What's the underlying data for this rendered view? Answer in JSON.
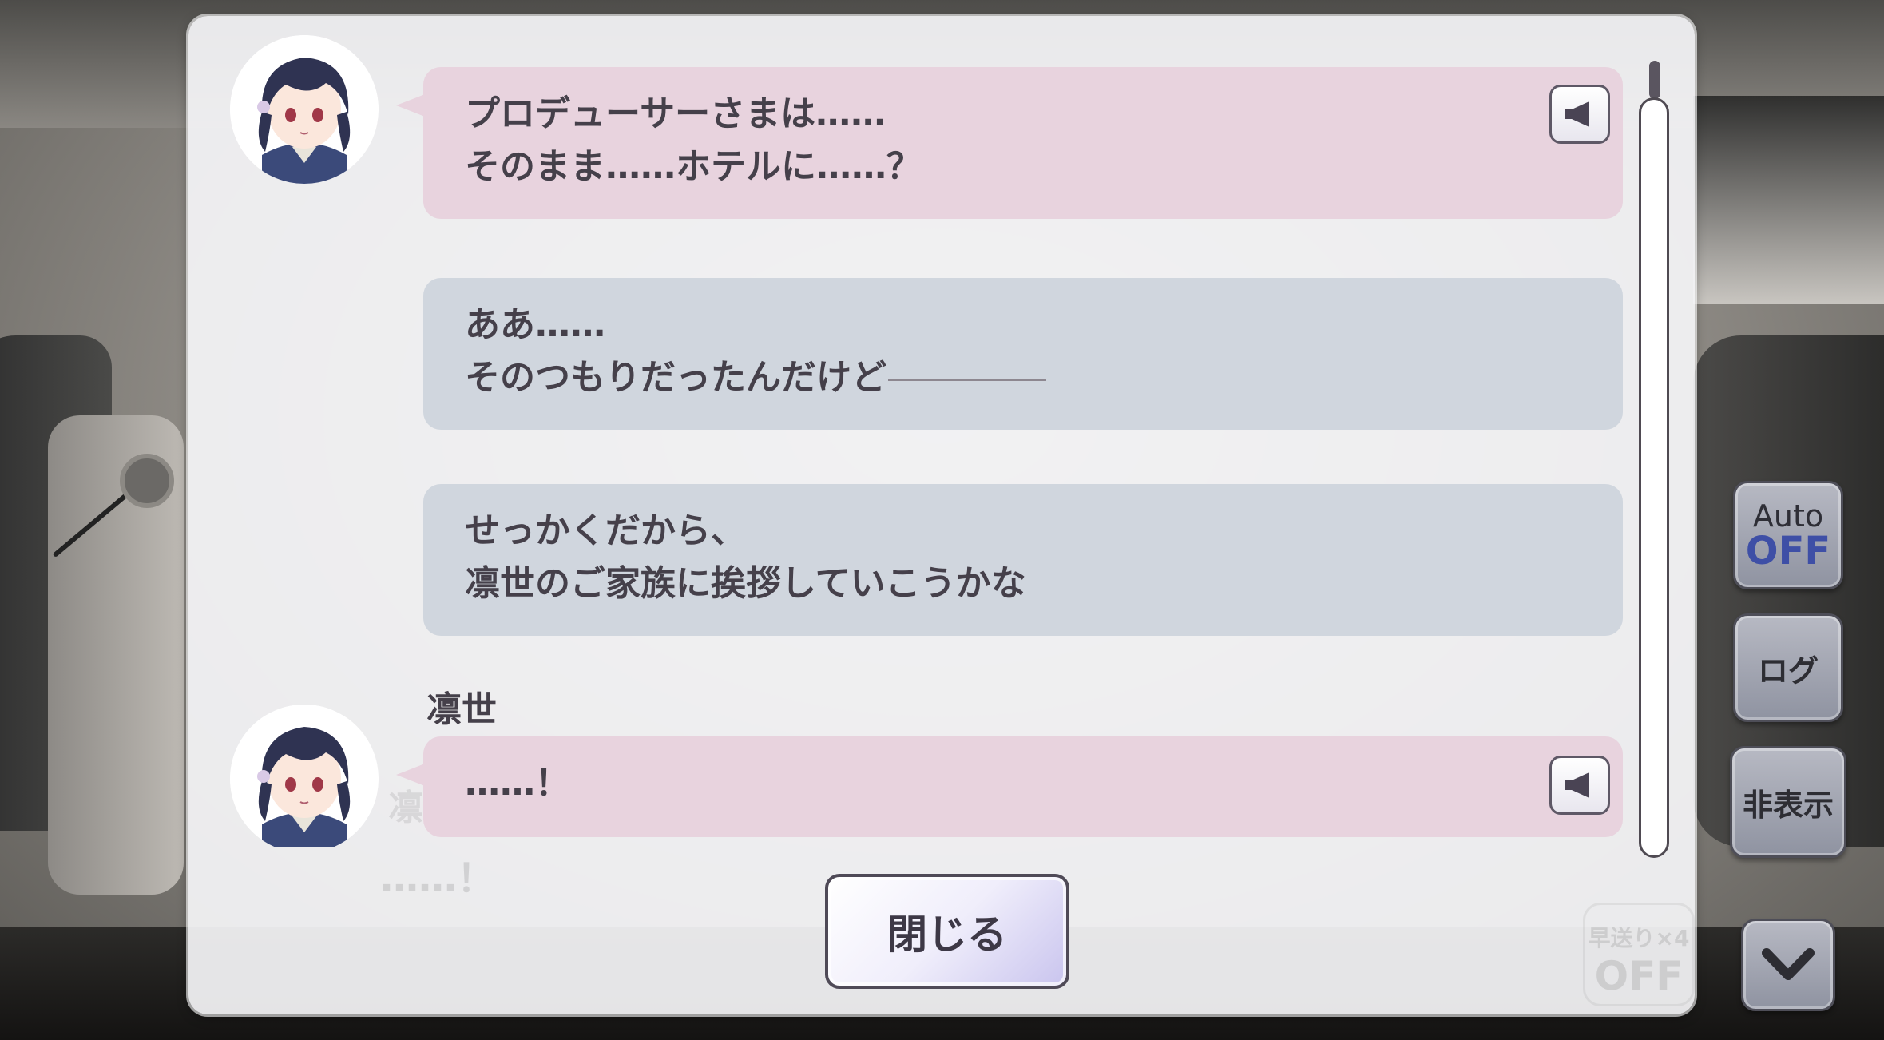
{
  "log": {
    "entries": [
      {
        "speaker": "",
        "lines": [
          "プロデューサーさまは……",
          "そのまま……ホテルに……？"
        ],
        "style": "character",
        "has_voice": true
      },
      {
        "speaker": "",
        "lines": [
          "ああ……",
          "そのつもりだったんだけど"
        ],
        "style": "producer",
        "has_voice": false
      },
      {
        "speaker": "",
        "lines": [
          "せっかくだから、",
          "凛世のご家族に挨拶していこうかな"
        ],
        "style": "producer",
        "has_voice": false
      },
      {
        "speaker": "凛世",
        "lines": [
          "……！"
        ],
        "style": "character",
        "has_voice": true
      }
    ],
    "close_label": "閉じる"
  },
  "background_dialog": {
    "name": "凛",
    "text": "……！",
    "fast_forward_top": "早送り×4",
    "fast_forward_bottom": "OFF"
  },
  "controls": {
    "auto_label": "Auto",
    "auto_state": "OFF",
    "log_label": "ログ",
    "hide_label": "非表示"
  },
  "colors": {
    "character_bubble": "#e8d3de",
    "producer_bubble": "#d0d6de",
    "text": "#45404a",
    "auto_off": "#3e4fa6"
  },
  "icons": [
    "speaker-icon",
    "chevron-down-icon",
    "character-avatar"
  ]
}
